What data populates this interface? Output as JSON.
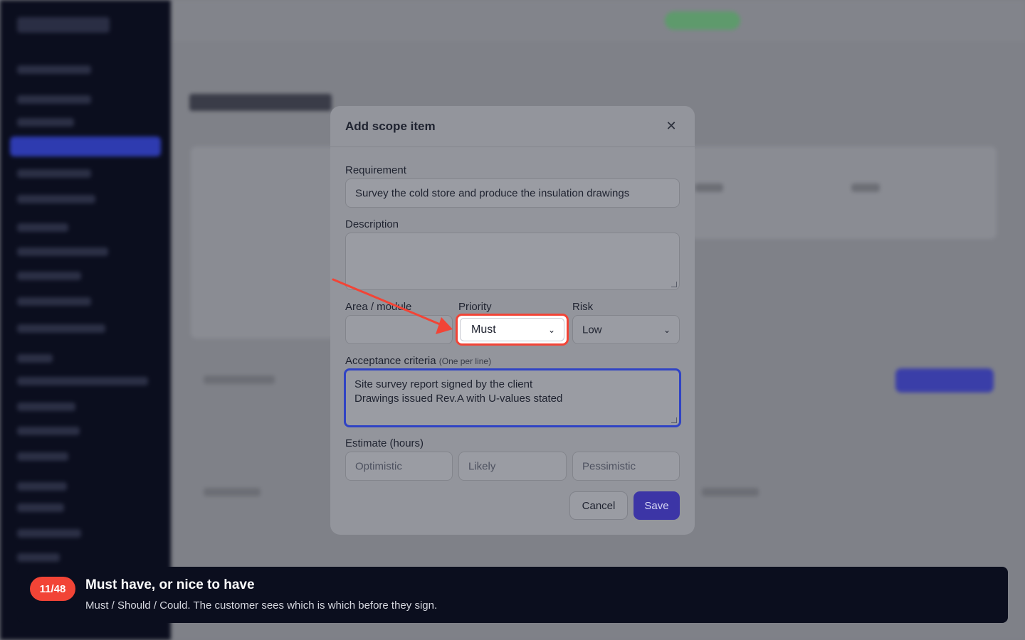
{
  "modal": {
    "title": "Add scope item",
    "close_icon": "close-icon",
    "requirement": {
      "label": "Requirement",
      "value": "Survey the cold store and produce the insulation drawings"
    },
    "description": {
      "label": "Description",
      "value": ""
    },
    "area": {
      "label": "Area / module",
      "value": ""
    },
    "priority": {
      "label": "Priority",
      "selected": "Must"
    },
    "risk": {
      "label": "Risk",
      "selected": "Low"
    },
    "acceptance": {
      "label": "Acceptance criteria",
      "hint": "(One per line)",
      "lines": [
        "Site survey report signed by the client",
        "Drawings issued Rev.A with U-values stated"
      ]
    },
    "estimate": {
      "label": "Estimate (hours)",
      "optimistic_placeholder": "Optimistic",
      "likely_placeholder": "Likely",
      "pessimistic_placeholder": "Pessimistic"
    },
    "cancel_label": "Cancel",
    "save_label": "Save"
  },
  "tour": {
    "step": "11/48",
    "title": "Must have, or nice to have",
    "body": "Must / Should / Could. The customer sees which is which before they sign.",
    "highlight_color": "#f24436"
  },
  "colors": {
    "accent": "#3c35a6",
    "focus": "#3043c4",
    "sidebar": "#0b0e1e"
  }
}
